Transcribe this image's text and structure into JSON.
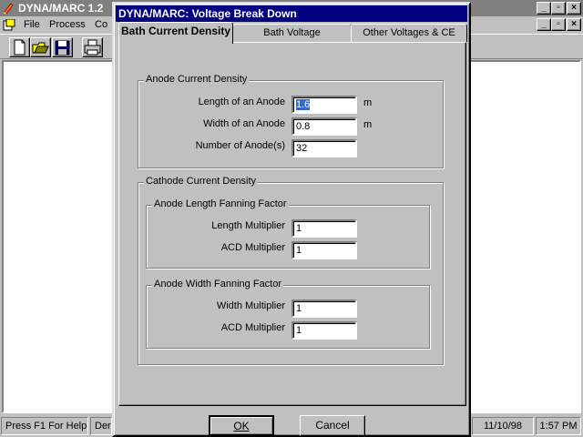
{
  "app": {
    "title": "DYNA/MARC 1.2"
  },
  "menu": {
    "items": [
      {
        "label": "File",
        "hotkey": "F"
      },
      {
        "label": "Process",
        "hotkey": "P"
      },
      {
        "label": "Co",
        "hotkey": "C"
      }
    ]
  },
  "toolbar": {
    "buttons": [
      "new-file-icon",
      "open-folder-icon",
      "save-disk-icon",
      "print-icon"
    ]
  },
  "window_controls": {
    "minimize": "_",
    "restore": "▫",
    "close": "×"
  },
  "dialog": {
    "title": "DYNA/MARC: Voltage Break Down",
    "tabs": [
      {
        "label": "Bath Current Density",
        "active": true
      },
      {
        "label": "Bath Voltage",
        "active": false
      },
      {
        "label": "Other Voltages & CE",
        "active": false
      }
    ],
    "anode": {
      "group_label": "Anode Current Density",
      "length_label": "Length of an Anode",
      "length_value": "1.6",
      "length_unit": "m",
      "width_label": "Width of an Anode",
      "width_value": "0.8",
      "width_unit": "m",
      "count_label": "Number of Anode(s)",
      "count_value": "32"
    },
    "cathode": {
      "group_label": "Cathode Current Density",
      "length_group_label": "Anode Length Fanning Factor",
      "length_multiplier_label": "Length Multiplier",
      "length_multiplier_value": "1",
      "length_acd_label": "ACD Multiplier",
      "length_acd_value": "1",
      "width_group_label": "Anode Width Fanning Factor",
      "width_multiplier_label": "Width Multiplier",
      "width_multiplier_value": "1",
      "width_acd_label": "ACD Multiplier",
      "width_acd_value": "1"
    },
    "ok_label": "OK",
    "cancel_label": "Cancel"
  },
  "status": {
    "help": "Press F1 For Help",
    "mode": "Den",
    "date": "11/10/98",
    "time": "1:57 PM"
  },
  "colors": {
    "titlebar_active": "#000080",
    "titlebar_inactive": "#808080",
    "face": "#c0c0c0"
  }
}
